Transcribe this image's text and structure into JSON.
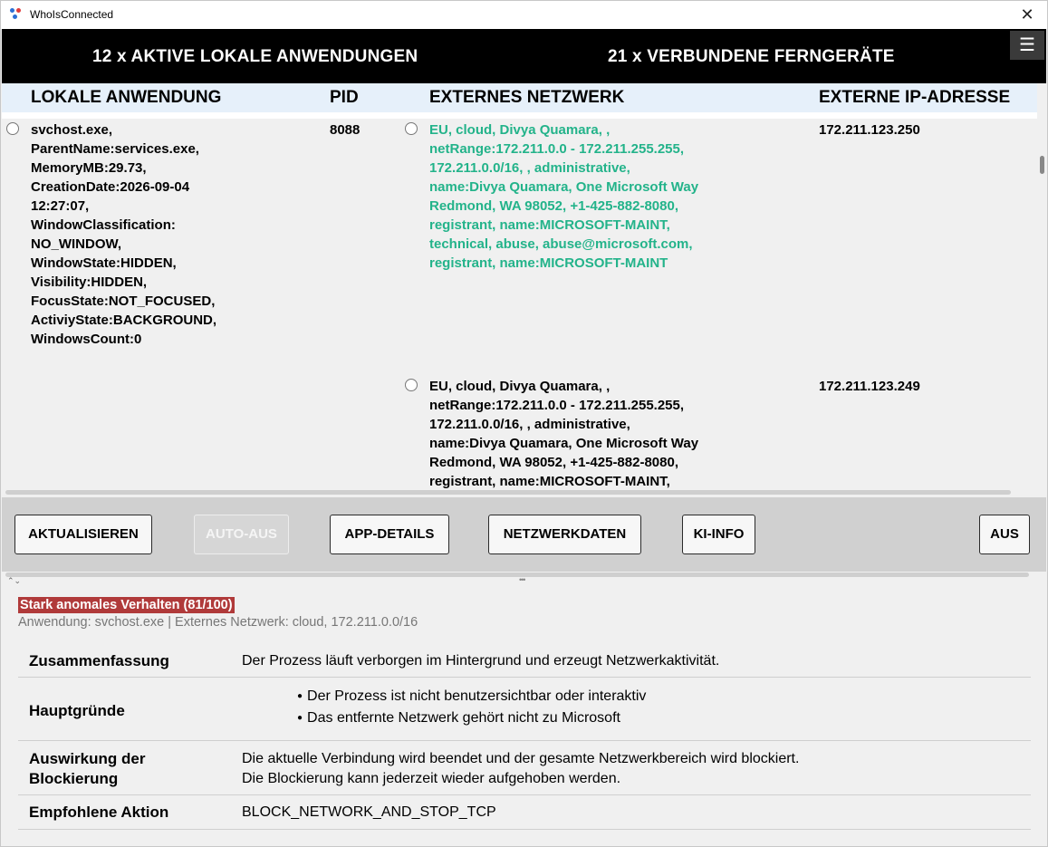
{
  "window": {
    "title": "WhoIsConnected",
    "close_glyph": "✕"
  },
  "header": {
    "left": "12 x AKTIVE LOKALE ANWENDUNGEN",
    "right": "21 x VERBUNDENE FERNGERÄTE",
    "menu_glyph": "☰"
  },
  "table": {
    "columns": [
      "LOKALE ANWENDUNG",
      "PID",
      "EXTERNES NETZWERK",
      "EXTERNE IP-ADRESSE"
    ],
    "app": {
      "lines": [
        "svchost.exe,",
        "ParentName:services.exe,",
        "MemoryMB:29.73,",
        "CreationDate:2026-09-04",
        "12:27:07,",
        "WindowClassification:",
        "NO_WINDOW,",
        "WindowState:HIDDEN,",
        "Visibility:HIDDEN,",
        "FocusState:NOT_FOCUSED,",
        "ActiviyState:BACKGROUND,",
        "WindowsCount:0"
      ],
      "pid": "8088"
    },
    "connections": [
      {
        "network_lines": [
          "EU, cloud, Divya Quamara, ,",
          "netRange:172.211.0.0 - 172.211.255.255,",
          "172.211.0.0/16, , administrative,",
          "name:Divya Quamara, One Microsoft Way",
          "Redmond, WA 98052, +1-425-882-8080,",
          "registrant, name:MICROSOFT-MAINT,",
          "technical, abuse, abuse@microsoft.com,",
          "registrant, name:MICROSOFT-MAINT"
        ],
        "ip": "172.211.123.250",
        "highlight_color": "#23b38a"
      },
      {
        "network_lines": [
          "EU, cloud, Divya Quamara, ,",
          "netRange:172.211.0.0 - 172.211.255.255,",
          "172.211.0.0/16, , administrative,",
          "name:Divya Quamara, One Microsoft Way",
          "Redmond, WA 98052, +1-425-882-8080,",
          "registrant, name:MICROSOFT-MAINT,"
        ],
        "ip": "172.211.123.249"
      }
    ]
  },
  "buttons": {
    "refresh": "AKTUALISIEREN",
    "auto_off": "AUTO-AUS",
    "app_details": "APP-DETAILS",
    "network_data": "NETZWERKDATEN",
    "ai_info": "KI-INFO",
    "off": "AUS"
  },
  "splitter": {
    "chevrons": "⌃⌄",
    "grip": "•••"
  },
  "detail": {
    "anomaly": "Stark anomales Verhalten (81/100)",
    "anomaly_color": "#b03a3a",
    "subtitle": "Anwendung: svchost.exe  |  Externes Netzwerk: cloud, 172.211.0.0/16",
    "summary_label": "Zusammenfassung",
    "summary_value": "Der Prozess läuft verborgen im Hintergrund und erzeugt Netzwerkaktivität.",
    "reasons_label": "Hauptgründe",
    "reasons": [
      "Der Prozess ist nicht benutzersichtbar oder interaktiv",
      "Das entfernte Netzwerk gehört nicht zu Microsoft"
    ],
    "impact_label_1": "Auswirkung der",
    "impact_label_2": "Blockierung",
    "impact_value_1": "Die aktuelle Verbindung wird beendet und der gesamte Netzwerkbereich wird blockiert.",
    "impact_value_2": "Die Blockierung kann jederzeit wieder aufgehoben werden.",
    "action_label": "Empfohlene Aktion",
    "action_value": "BLOCK_NETWORK_AND_STOP_TCP"
  }
}
